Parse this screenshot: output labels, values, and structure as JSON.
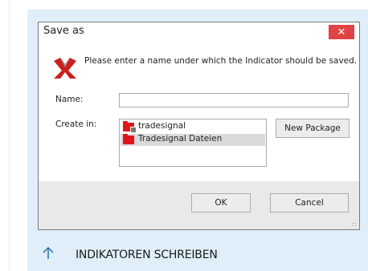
{
  "dialog": {
    "title": "Save as",
    "close_icon": "close-icon",
    "message": "Please enter a name under which the Indicator should be saved.",
    "name_label": "Name:",
    "name_value": "",
    "create_in_label": "Create in:",
    "tree": [
      {
        "label": "tradesignal",
        "icon": "locked-folder-icon",
        "selected": false
      },
      {
        "label": "Tradesignal Dateien",
        "icon": "folder-icon",
        "selected": true
      }
    ],
    "new_package_label": "New Package",
    "ok_label": "OK",
    "cancel_label": "Cancel"
  },
  "nav": {
    "back_label": "INDIKATOREN SCHREIBEN",
    "back_icon": "arrow-up-icon"
  },
  "colors": {
    "page_bg": "#dfeef8",
    "close_red": "#e04343",
    "folder_red": "#e0161b"
  }
}
